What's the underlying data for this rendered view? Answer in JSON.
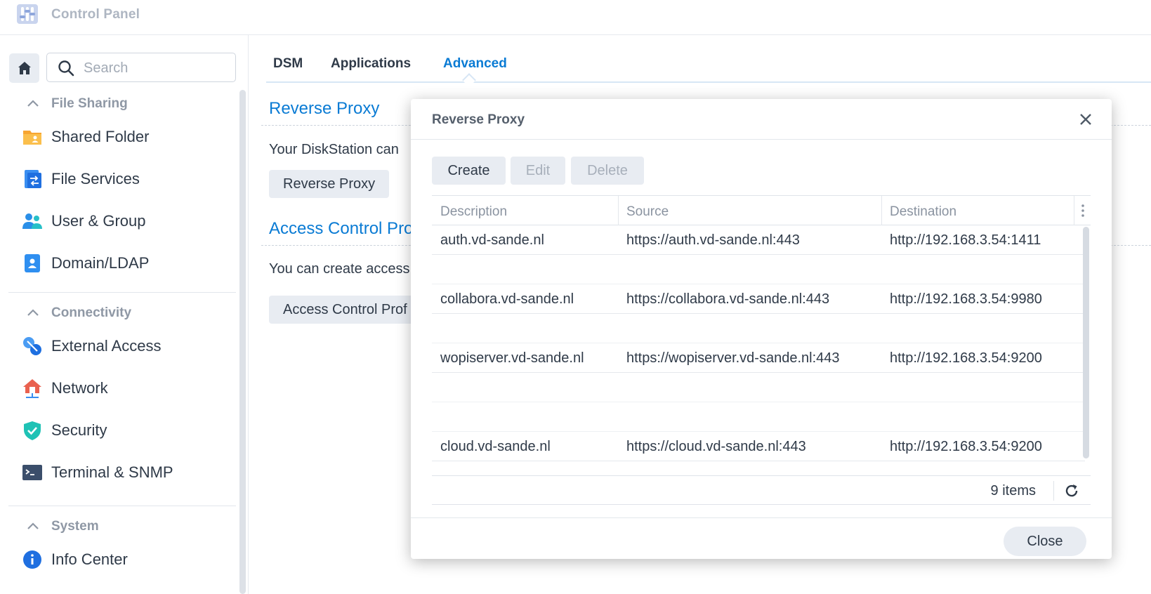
{
  "app": {
    "title": "Control Panel"
  },
  "sidebar": {
    "search_placeholder": "Search",
    "groups": [
      {
        "label": "File Sharing",
        "items": [
          {
            "label": "Shared Folder",
            "icon": "shared-folder-icon"
          },
          {
            "label": "File Services",
            "icon": "file-services-icon"
          },
          {
            "label": "User & Group",
            "icon": "user-group-icon"
          },
          {
            "label": "Domain/LDAP",
            "icon": "domain-ldap-icon"
          }
        ]
      },
      {
        "label": "Connectivity",
        "items": [
          {
            "label": "External Access",
            "icon": "external-access-icon"
          },
          {
            "label": "Network",
            "icon": "network-icon"
          },
          {
            "label": "Security",
            "icon": "shield-check-icon"
          },
          {
            "label": "Terminal & SNMP",
            "icon": "terminal-icon"
          }
        ]
      },
      {
        "label": "System",
        "items": [
          {
            "label": "Info Center",
            "icon": "info-icon"
          }
        ]
      }
    ]
  },
  "tabs": [
    {
      "label": "DSM",
      "active": false
    },
    {
      "label": "Applications",
      "active": false
    },
    {
      "label": "Advanced",
      "active": true
    }
  ],
  "main": {
    "reverse_proxy": {
      "title": "Reverse Proxy",
      "text": "Your DiskStation can",
      "button": "Reverse Proxy"
    },
    "access_control": {
      "title": "Access Control Pro",
      "text": "You can create access",
      "button": "Access Control Prof"
    }
  },
  "modal": {
    "title": "Reverse Proxy",
    "toolbar": {
      "create": "Create",
      "edit": "Edit",
      "delete": "Delete"
    },
    "columns": {
      "description": "Description",
      "source": "Source",
      "destination": "Destination"
    },
    "rows": [
      {
        "description": "auth.vd-sande.nl",
        "source": "https://auth.vd-sande.nl:443",
        "destination": "http://192.168.3.54:1411"
      },
      {
        "description": "collabora.vd-sande.nl",
        "source": "https://collabora.vd-sande.nl:443",
        "destination": "http://192.168.3.54:9980"
      },
      {
        "description": "wopiserver.vd-sande.nl",
        "source": "https://wopiserver.vd-sande.nl:443",
        "destination": "http://192.168.3.54:9200"
      },
      {
        "description": "cloud.vd-sande.nl",
        "source": "https://cloud.vd-sande.nl:443",
        "destination": "http://192.168.3.54:9200"
      }
    ],
    "item_count": "9 items",
    "close_label": "Close"
  },
  "colors": {
    "accent": "#0a7bd4",
    "text": "#2f3a48",
    "muted": "#8f98a5",
    "button_bg": "#e8ecf2"
  }
}
